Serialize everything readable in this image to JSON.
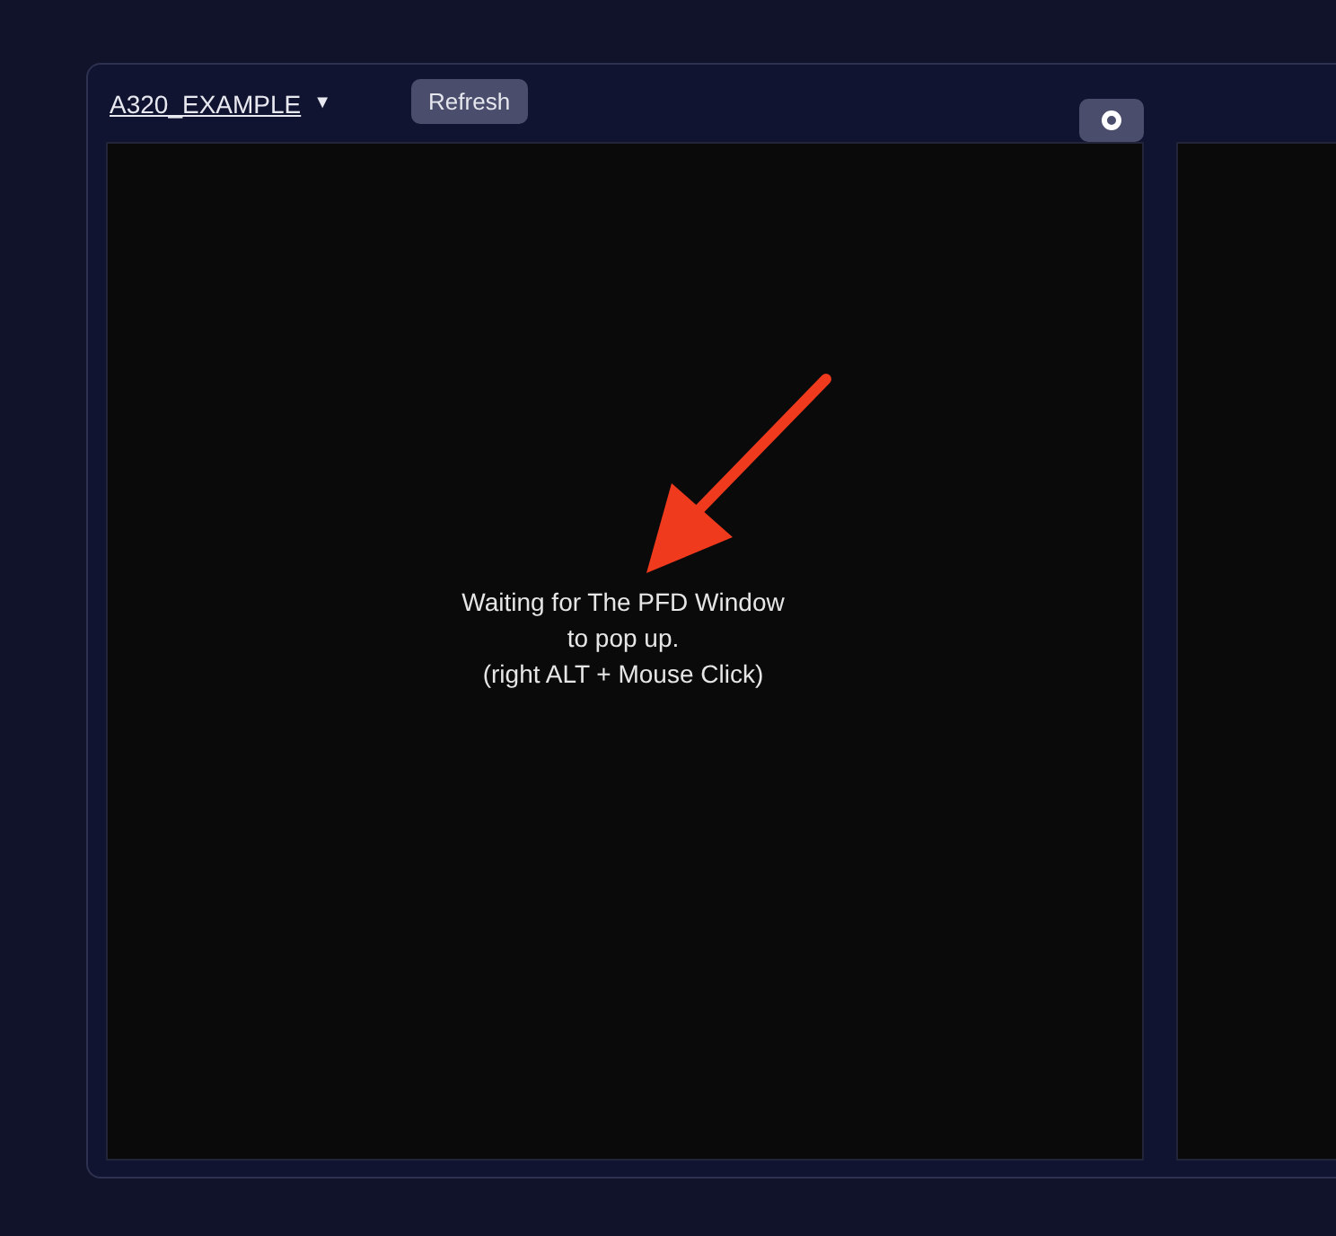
{
  "header": {
    "aircraft": "A320_EXAMPLE",
    "caret": "▼",
    "refresh_button": "Refresh",
    "toggle": {
      "on": true
    }
  },
  "screens": [
    {
      "kind": "waiting",
      "message": "Waiting for The PFD Window\nto pop up.\n(right ALT + Mouse Click)"
    },
    {
      "kind": "blank"
    }
  ]
}
